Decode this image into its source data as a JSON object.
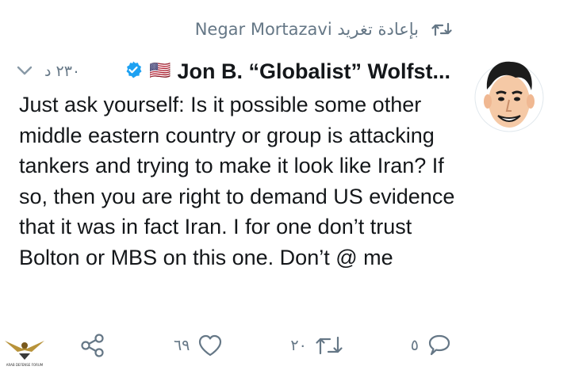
{
  "retweet": {
    "text": "Negar Mortazavi بإعادة تغريد",
    "icon": "retweet-icon"
  },
  "tweet": {
    "author_name": "Jon B. “Globalist” Wolfst...",
    "flag": "🇺🇸",
    "verified": true,
    "time": "٢٣٠ د",
    "text": "Just ask yourself: Is it possible some other middle eastern country or group is attacking tankers and trying to make it look like Iran? If so, then you are right to demand US evidence that it was in fact Iran. I for one don’t trust Bolton or MBS on this one. Don’t @ me",
    "avatar": "cartoon-face-avatar"
  },
  "actions": {
    "share_icon": "share-icon",
    "likes": "٦٩",
    "retweets": "٢٠",
    "replies": "٥"
  },
  "watermark": {
    "label": "ARAB DEFENSE FORUM"
  },
  "colors": {
    "verified": "#1da1f2",
    "muted": "#657786",
    "text": "#14171a"
  }
}
